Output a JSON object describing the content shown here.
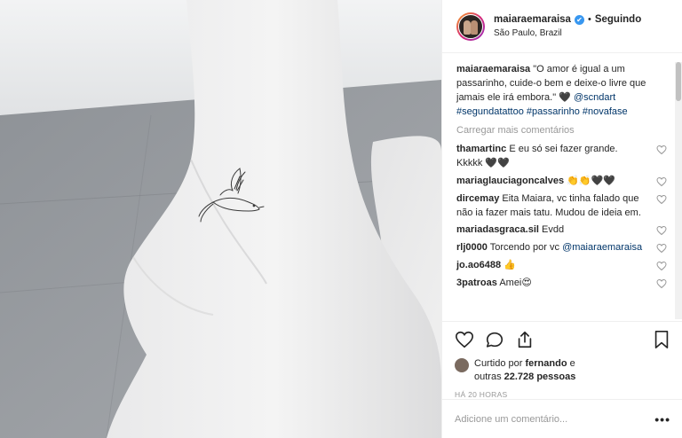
{
  "post": {
    "username": "maiaraemaraisa",
    "verified_icon": "✔",
    "dot": "•",
    "follow_status": "Seguindo",
    "location": "São Paulo, Brazil"
  },
  "caption": {
    "username": "maiaraemaraisa",
    "text": "\"O amor é igual a um passarinho, cuide-o bem e deixe-o livre que jamais ele irá embora.\" 🖤 ",
    "mention": "@scndart",
    "hashtags": "#segundatattoo #passarinho #novafase"
  },
  "load_more": "Carregar mais comentários",
  "comments": [
    {
      "user": "thamartinc",
      "text": "E eu só sei fazer grande. Kkkkk 🖤🖤"
    },
    {
      "user": "mariaglauciagoncalves",
      "text": "👏👏🖤🖤"
    },
    {
      "user": "dircemay",
      "text": "Eita Maiara, vc tinha falado que não ia fazer mais tatu. Mudou de ideia em."
    },
    {
      "user": "mariadasgraca.sil",
      "text": "Evdd"
    },
    {
      "user": "rlj0000",
      "text": "Torcendo por vc",
      "mention": "@maiaraemaraisa"
    },
    {
      "user": "jo.ao6488",
      "text": "👍"
    },
    {
      "user": "3patroas",
      "text": "Amei😍"
    }
  ],
  "likes": {
    "prefix": "Curtido por ",
    "user": "fernando",
    "middle": " e",
    "rest": "outras ",
    "count": "22.728 pessoas"
  },
  "time_ago": "HÁ 20 HORAS",
  "add_comment": {
    "placeholder": "Adicione um comentário..."
  },
  "options": "•••",
  "icons": {
    "like": "heart-icon",
    "comment": "comment-icon",
    "share": "share-icon",
    "save": "bookmark-icon"
  }
}
